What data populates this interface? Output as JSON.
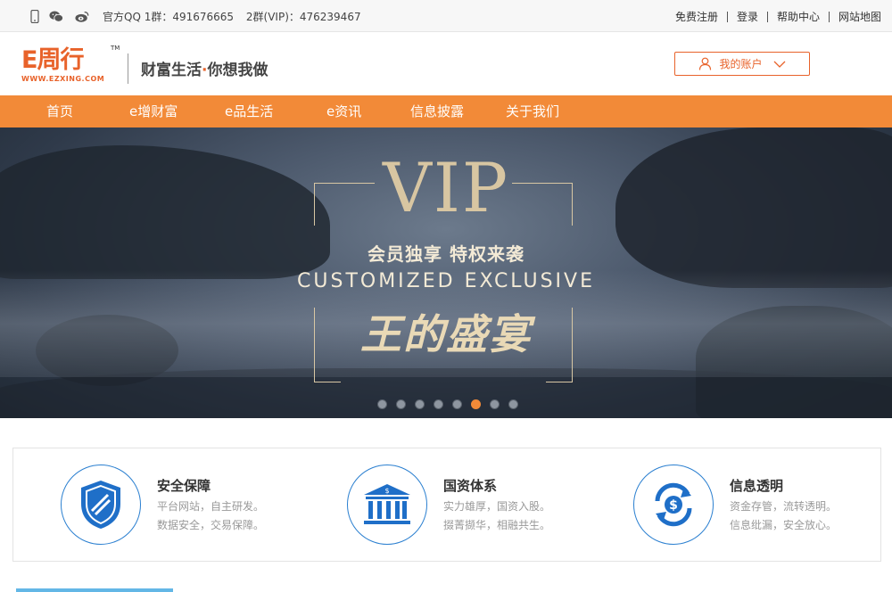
{
  "topbar": {
    "qq_label": "官方QQ 1群：491676665",
    "qq_vip": "2群(VIP)：476239467",
    "links": [
      "免费注册",
      "登录",
      "帮助中心",
      "网站地图"
    ]
  },
  "header": {
    "logo_mark": "E周行",
    "logo_tm": "TM",
    "logo_url": "WWW.EZXING.COM",
    "slogan_left": "财富生活",
    "slogan_dot": "·",
    "slogan_right": "你想我做",
    "account_label": "我的账户"
  },
  "nav": {
    "items": [
      "首页",
      "e增财富",
      "e品生活",
      "e资讯",
      "信息披露",
      "关于我们"
    ]
  },
  "banner": {
    "vip": "VIP",
    "line1": "会员独享 特权来袭",
    "line2": "CUSTOMIZED EXCLUSIVE",
    "line3": "王的盛宴",
    "slide_count": 8,
    "active_slide": 6
  },
  "features": [
    {
      "icon": "shield-icon",
      "title": "安全保障",
      "line1": "平台网站，自主研发。",
      "line2": "数据安全，交易保障。"
    },
    {
      "icon": "bank-icon",
      "title": "国资体系",
      "line1": "实力雄厚，国资入股。",
      "line2": "掇菁撷华，相融共生。"
    },
    {
      "icon": "money-cycle-icon",
      "title": "信息透明",
      "line1": "资金存管，流转透明。",
      "line2": "信息纰漏，安全放心。"
    }
  ],
  "colors": {
    "brand": "#e8622a",
    "nav": "#f28a38",
    "icon_blue": "#1f6fc8"
  }
}
